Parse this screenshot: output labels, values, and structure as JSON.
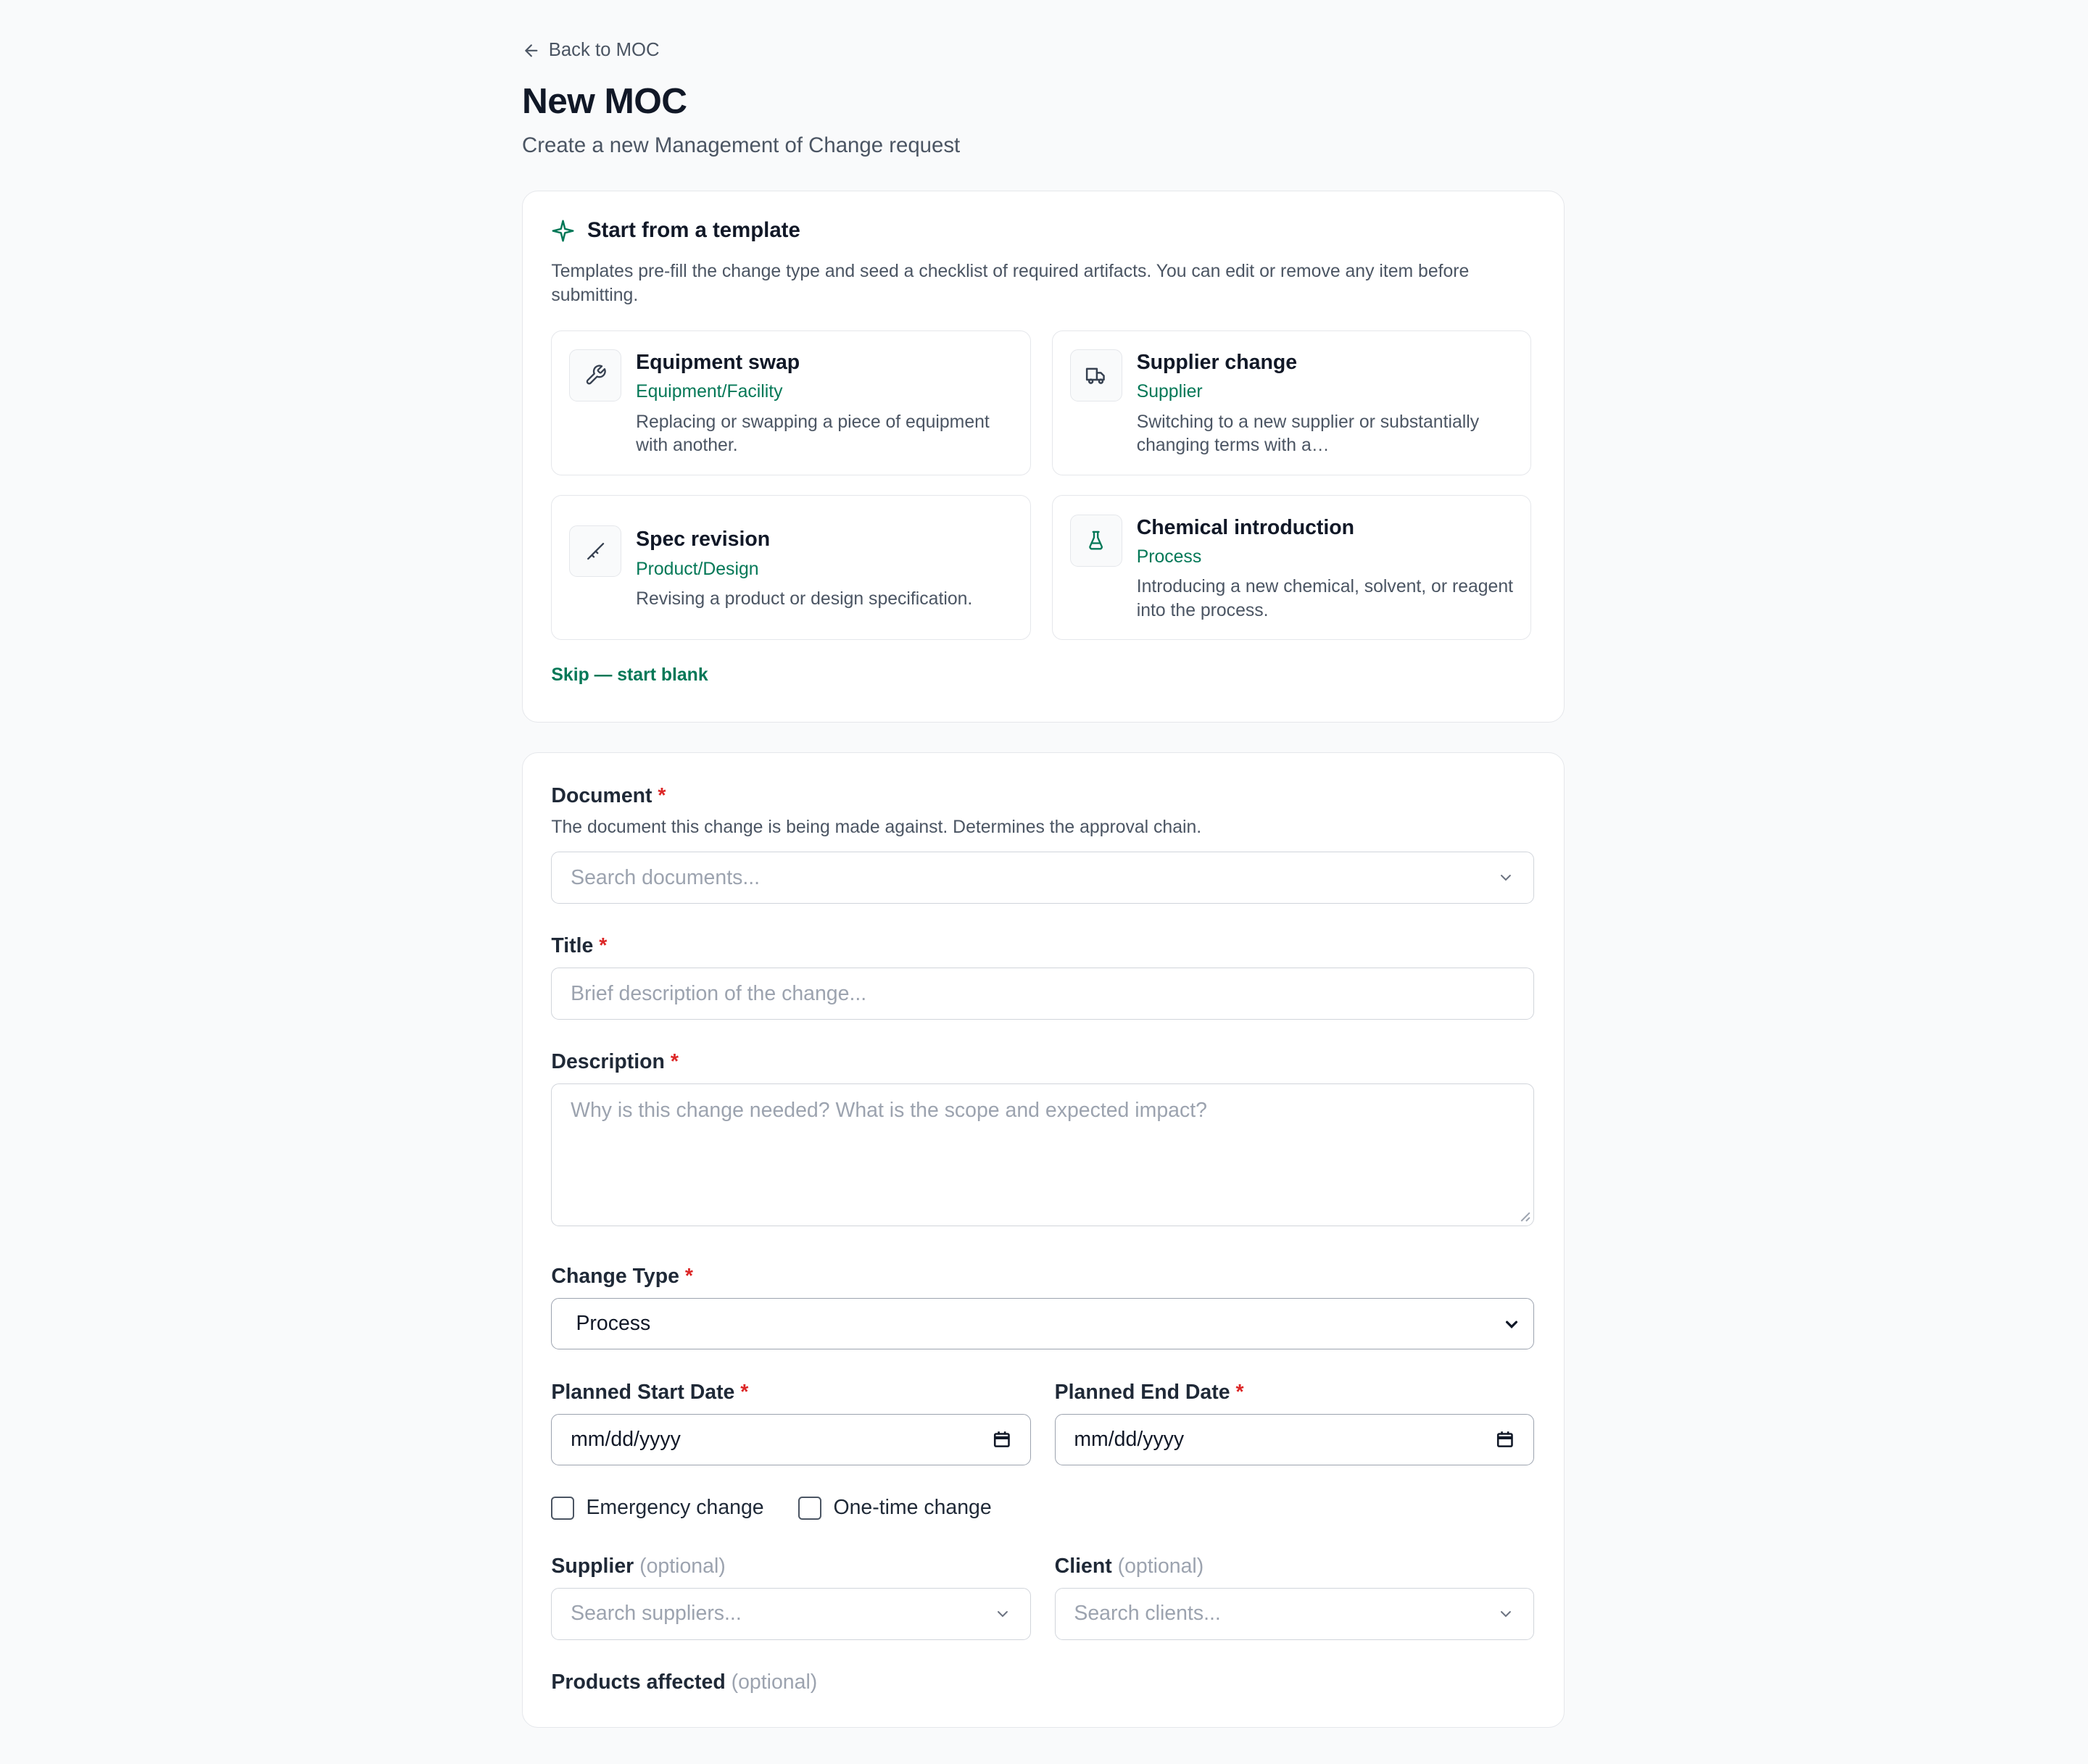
{
  "nav": {
    "back_label": "Back to MOC"
  },
  "page": {
    "title": "New MOC",
    "subtitle": "Create a new Management of Change request"
  },
  "templates": {
    "header": "Start from a template",
    "description": "Templates pre-fill the change type and seed a checklist of required artifacts. You can edit or remove any item before submitting.",
    "items": [
      {
        "name": "Equipment swap",
        "type": "Equipment/Facility",
        "description": "Replacing or swapping a piece of equipment with another.",
        "icon": "wrench-icon"
      },
      {
        "name": "Supplier change",
        "type": "Supplier",
        "description": "Switching to a new supplier or substantially changing terms with a…",
        "icon": "truck-icon"
      },
      {
        "name": "Spec revision",
        "type": "Product/Design",
        "description": "Revising a product or design specification.",
        "icon": "ruler-icon"
      },
      {
        "name": "Chemical introduction",
        "type": "Process",
        "description": "Introducing a new chemical, solvent, or reagent into the process.",
        "icon": "flask-icon"
      }
    ],
    "skip_label": "Skip — start blank"
  },
  "form": {
    "document": {
      "label": "Document",
      "required": "*",
      "help": "The document this change is being made against. Determines the approval chain.",
      "placeholder": "Search documents..."
    },
    "title": {
      "label": "Title",
      "required": "*",
      "placeholder": "Brief description of the change..."
    },
    "description": {
      "label": "Description",
      "required": "*",
      "placeholder": "Why is this change needed? What is the scope and expected impact?"
    },
    "change_type": {
      "label": "Change Type",
      "required": "*",
      "value": "Process"
    },
    "start_date": {
      "label": "Planned Start Date",
      "required": "*",
      "value": "mm/dd/yyyy"
    },
    "end_date": {
      "label": "Planned End Date",
      "required": "*",
      "value": "mm/dd/yyyy"
    },
    "checkboxes": [
      {
        "label": "Emergency change",
        "checked": false
      },
      {
        "label": "One-time change",
        "checked": false
      }
    ],
    "supplier": {
      "label": "Supplier",
      "optional": "(optional)",
      "placeholder": "Search suppliers..."
    },
    "client": {
      "label": "Client",
      "optional": "(optional)",
      "placeholder": "Search clients..."
    },
    "products": {
      "label": "Products affected",
      "optional": "(optional)"
    }
  },
  "colors": {
    "accent": "#047857",
    "required": "#dc2626",
    "border": "#e5e7eb",
    "background": "#f9fafb"
  }
}
